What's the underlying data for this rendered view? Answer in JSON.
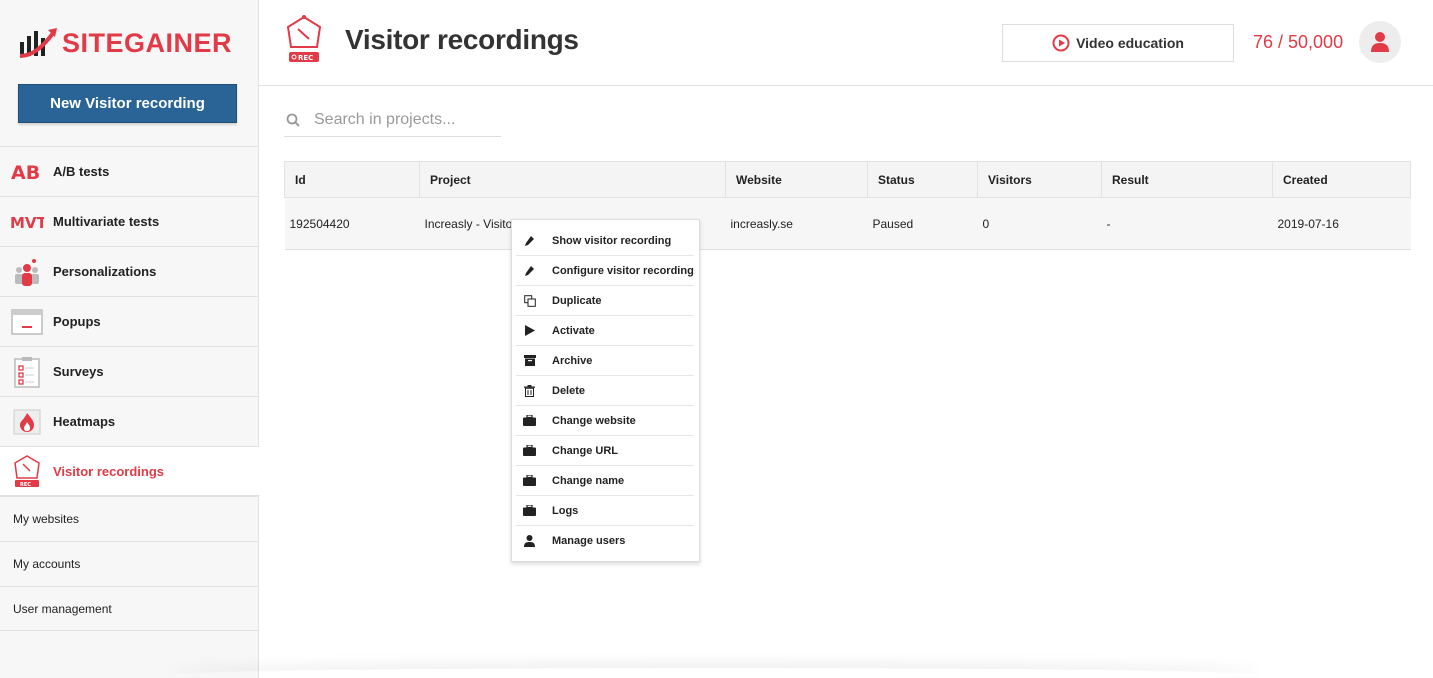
{
  "brand": {
    "logo_text": "SITEGAINER",
    "accent": "#e23a46",
    "primary": "#2a6496"
  },
  "sidebar": {
    "new_button": "New Visitor recording",
    "items": [
      {
        "label": "A/B tests",
        "icon": "ab-tests-icon"
      },
      {
        "label": "Multivariate tests",
        "icon": "multivariate-icon"
      },
      {
        "label": "Personalizations",
        "icon": "personalizations-icon"
      },
      {
        "label": "Popups",
        "icon": "popups-icon"
      },
      {
        "label": "Surveys",
        "icon": "surveys-icon"
      },
      {
        "label": "Heatmaps",
        "icon": "heatmaps-icon"
      },
      {
        "label": "Visitor recordings",
        "icon": "visitor-recordings-icon",
        "active": true
      }
    ],
    "sub_items": [
      {
        "label": "My websites"
      },
      {
        "label": "My accounts"
      },
      {
        "label": "User management"
      }
    ]
  },
  "header": {
    "icon_label": "REC",
    "title": "Visitor recordings",
    "video_button": "Video education",
    "counter": "76 / 50,000"
  },
  "search": {
    "placeholder": "Search in projects..."
  },
  "table": {
    "columns": [
      "Id",
      "Project",
      "Website",
      "Status",
      "Visitors",
      "Result",
      "Created"
    ],
    "rows": [
      {
        "id": "192504420",
        "project": "Increasly - Visito",
        "website": "increasly.se",
        "status": "Paused",
        "visitors": "0",
        "result": "-",
        "created": "2019-07-16"
      }
    ]
  },
  "context_menu": {
    "items": [
      {
        "label": "Show visitor recording",
        "icon": "pencil-icon"
      },
      {
        "label": "Configure visitor recording",
        "icon": "pencil-icon"
      },
      {
        "label": "Duplicate",
        "icon": "duplicate-icon"
      },
      {
        "label": "Activate",
        "icon": "play-icon"
      },
      {
        "label": "Archive",
        "icon": "archive-icon"
      },
      {
        "label": "Delete",
        "icon": "trash-icon"
      },
      {
        "label": "Change website",
        "icon": "briefcase-icon"
      },
      {
        "label": "Change URL",
        "icon": "briefcase-icon"
      },
      {
        "label": "Change name",
        "icon": "briefcase-icon"
      },
      {
        "label": "Logs",
        "icon": "briefcase-icon"
      },
      {
        "label": "Manage users",
        "icon": "user-icon"
      }
    ]
  }
}
